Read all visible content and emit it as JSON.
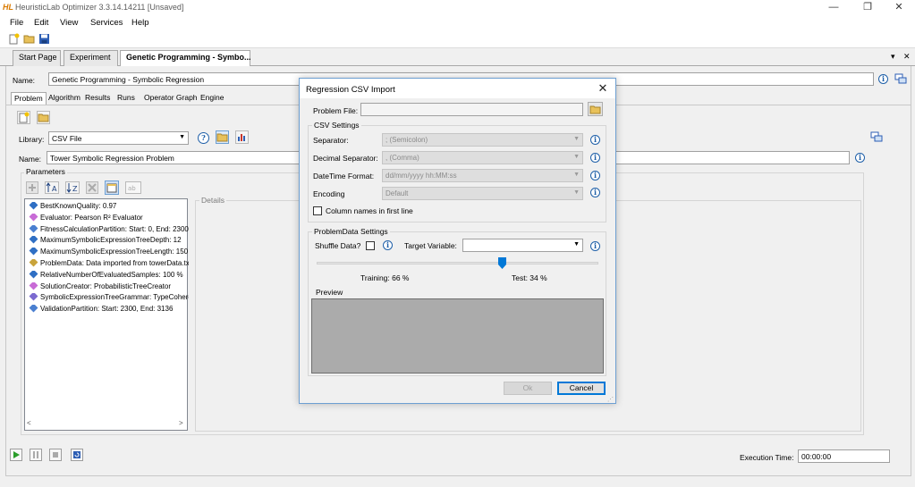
{
  "window": {
    "logo": "HL",
    "title": "HeuristicLab Optimizer 3.3.14.14211 [Unsaved]",
    "controls": {
      "minimize": "—",
      "maximize": "❐",
      "close": "✕"
    }
  },
  "menu": [
    "File",
    "Edit",
    "View",
    "Services",
    "Help"
  ],
  "toolbar": {
    "icons": [
      "new-file-icon",
      "open-folder-icon",
      "save-icon"
    ]
  },
  "tabs": [
    {
      "label": "Start Page",
      "active": false
    },
    {
      "label": "Experiment",
      "active": false
    },
    {
      "label": "Genetic Programming - Symbo...",
      "active": true,
      "close": "×"
    }
  ],
  "tabstrip_dropdown": "▾",
  "tabstrip_close": "✕",
  "main": {
    "name_label": "Name:",
    "name_value": "Genetic Programming - Symbolic Regression",
    "subtabs": [
      "Problem",
      "Algorithm",
      "Results",
      "Runs",
      "Operator Graph",
      "Engine"
    ],
    "active_subtab": "Problem",
    "library_label": "Library:",
    "library_value": "CSV File",
    "problem_name_label": "Name:",
    "problem_name_value": "Tower Symbolic Regression Problem",
    "parameters_label": "Parameters",
    "details_label": "Details",
    "parameters": [
      "BestKnownQuality: 0.97",
      "Evaluator: Pearson R² Evaluator",
      "FitnessCalculationPartition: Start: 0, End: 2300",
      "MaximumSymbolicExpressionTreeDepth: 12",
      "MaximumSymbolicExpressionTreeLength: 150",
      "ProblemData: Data imported from towerData.txt",
      "RelativeNumberOfEvaluatedSamples: 100 %",
      "SolutionCreator: ProbabilisticTreeCreator",
      "SymbolicExpressionTreeGrammar: TypeCoherent",
      "ValidationPartition: Start: 2300, End: 3136"
    ],
    "parameter_colors": [
      "#2f6fc4",
      "#c86bd6",
      "#4a7fd0",
      "#2f6fc4",
      "#2f6fc4",
      "#c9a43b",
      "#2f6fc4",
      "#c86bd6",
      "#7b6ad0",
      "#4a7fd0"
    ],
    "scroll_left": "<",
    "scroll_right": ">",
    "execution_time_label": "Execution Time:",
    "execution_time_value": "00:00:00"
  },
  "dialog": {
    "title": "Regression CSV Import",
    "close": "✕",
    "problem_file_label": "Problem File:",
    "problem_file_value": "",
    "csv_settings_label": "CSV Settings",
    "separator_label": "Separator:",
    "separator_value": "; (Semicolon)",
    "decimal_label": "Decimal Separator:",
    "decimal_value": ", (Comma)",
    "datetime_label": "DateTime Format:",
    "datetime_value": "dd/mm/yyyy hh:MM:ss",
    "encoding_label": "Encoding",
    "encoding_value": "Default",
    "column_names_label": "Column names in first line",
    "column_names_checked": false,
    "problemdata_label": "ProblemData Settings",
    "shuffle_label": "Shuffle Data?",
    "shuffle_checked": false,
    "target_label": "Target Variable:",
    "target_value": "",
    "training_label": "Training: 66 %",
    "test_label": "Test: 34 %",
    "split_fraction": 0.66,
    "preview_label": "Preview",
    "ok_label": "Ok",
    "cancel_label": "Cancel"
  },
  "colors": {
    "accent_blue": "#0078d7",
    "info_blue": "#1e5fa8",
    "logo_orange": "#d97a00",
    "preview_gray": "#ababab"
  }
}
